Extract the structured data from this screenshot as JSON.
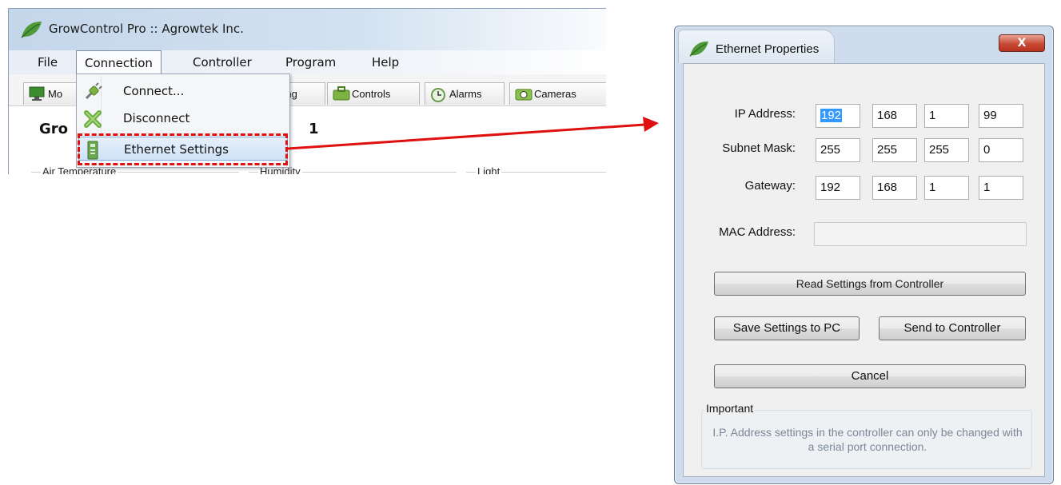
{
  "main_window": {
    "title": "GrowControl Pro :: Agrowtek Inc.",
    "menu": [
      "File",
      "Connection",
      "Controller",
      "Program",
      "Help"
    ],
    "tabs": [
      {
        "label": "Mo",
        "icon": "monitor-icon"
      },
      {
        "label": "gging",
        "icon": "logging-icon"
      },
      {
        "label": "Controls",
        "icon": "controls-icon"
      },
      {
        "label": "Alarms",
        "icon": "alarm-clock-icon"
      },
      {
        "label": "Cameras",
        "icon": "camera-icon"
      }
    ],
    "heading": "Gro",
    "heading_tail": "1",
    "groups": [
      "Air Temperature",
      "Humidity",
      "Light"
    ],
    "connection_menu": {
      "items": [
        {
          "label": "Connect...",
          "icon": "plug-icon"
        },
        {
          "label": "Disconnect",
          "icon": "disconnect-x-icon"
        },
        {
          "label": "Ethernet Settings",
          "icon": "ethernet-device-icon"
        }
      ]
    }
  },
  "dialog": {
    "title": "Ethernet Properties",
    "close_label": "X",
    "fields": {
      "ip": {
        "label": "IP Address:",
        "octets": [
          "192",
          "168",
          "1",
          "99"
        ]
      },
      "subnet": {
        "label": "Subnet Mask:",
        "octets": [
          "255",
          "255",
          "255",
          "0"
        ]
      },
      "gateway": {
        "label": "Gateway:",
        "octets": [
          "192",
          "168",
          "1",
          "1"
        ]
      },
      "mac": {
        "label": "MAC Address:",
        "value": ""
      }
    },
    "buttons": {
      "read": "Read Settings from Controller",
      "save": "Save Settings to PC",
      "send": "Send to Controller",
      "cancel": "Cancel"
    },
    "important": {
      "label": "Important",
      "text": "I.P. Address settings in the controller can only be changed with a serial port connection."
    }
  },
  "colors": {
    "highlight": "#e01010",
    "selection": "#3399ff",
    "leaf": "#4f9a3a"
  }
}
